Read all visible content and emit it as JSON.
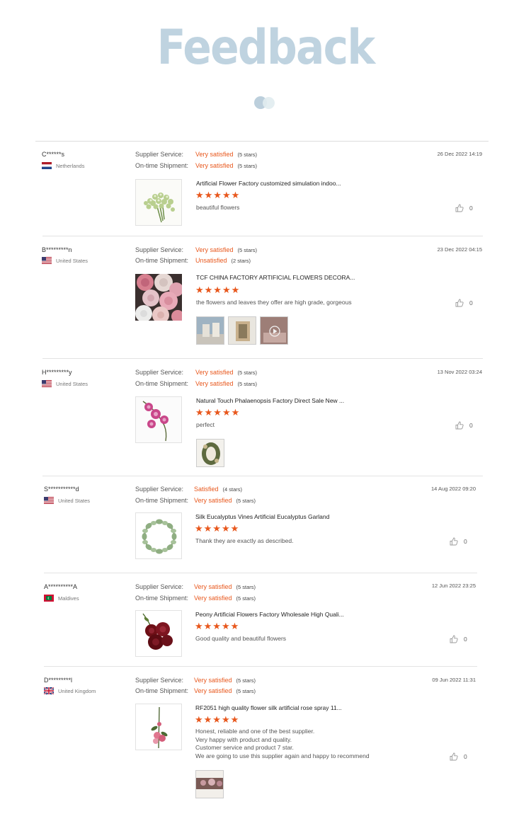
{
  "header": {
    "title": "Feedback"
  },
  "labels": {
    "supplier_service": "Supplier Service:",
    "shipment": "On-time Shipment:"
  },
  "reviews": [
    {
      "user": "C******s",
      "country": "Netherlands",
      "flag": "nl",
      "date": "26 Dec 2022 14:19",
      "supplier": {
        "text": "Very satisfied",
        "stars": "(5 stars)"
      },
      "shipment": {
        "text": "Very satisfied",
        "stars": "(5 stars)"
      },
      "product": "Artificial Flower Factory customized simulation indoo...",
      "rating": 5,
      "rating_text": "★★★★★",
      "comment": "beautiful flowers",
      "likes": "0",
      "thumb_icon": "baby-breath-flower-image"
    },
    {
      "user": "B*********n",
      "country": "United States",
      "flag": "us",
      "date": "23 Dec 2022 04:15",
      "supplier": {
        "text": "Very satisfied",
        "stars": "(5 stars)"
      },
      "shipment": {
        "text": "Unsatisfied",
        "stars": "(2 stars)"
      },
      "product": "TCF CHINA FACTORY ARTIFICIAL FLOWERS DECORA...",
      "rating": 5,
      "rating_text": "★★★★★",
      "comment": "the flowers and leaves they offer are high grade, gorgeous",
      "likes": "0",
      "thumb_icon": "pink-roses-image"
    },
    {
      "user": "H*********y",
      "country": "United States",
      "flag": "us",
      "date": "13 Nov 2022 03:24",
      "supplier": {
        "text": "Very satisfied",
        "stars": "(5 stars)"
      },
      "shipment": {
        "text": "Very satisfied",
        "stars": "(5 stars)"
      },
      "product": "Natural Touch Phalaenopsis Factory Direct Sale New ...",
      "rating": 5,
      "rating_text": "★★★★★",
      "comment": "perfect",
      "likes": "0",
      "thumb_icon": "orchid-image"
    },
    {
      "user": "S***********d",
      "country": "United States",
      "flag": "us",
      "date": "14 Aug 2022 09:20",
      "supplier": {
        "text": "Satisfied",
        "stars": "(4 stars)"
      },
      "shipment": {
        "text": "Very satisfied",
        "stars": "(5 stars)"
      },
      "product": "Silk Eucalyptus Vines Artificial Eucalyptus Garland",
      "rating": 5,
      "rating_text": "★★★★★",
      "comment": "Thank they are exactly as described.",
      "likes": "0",
      "thumb_icon": "eucalyptus-garland-image"
    },
    {
      "user": "A**********A",
      "country": "Maldives",
      "flag": "mv",
      "date": "12 Jun 2022 23:25",
      "supplier": {
        "text": "Very satisfied",
        "stars": "(5 stars)"
      },
      "shipment": {
        "text": "Very satisfied",
        "stars": "(5 stars)"
      },
      "product": "Peony Artificial Flowers Factory Wholesale High Quali...",
      "rating": 5,
      "rating_text": "★★★★★",
      "comment": "Good quality and beautiful flowers",
      "likes": "0",
      "thumb_icon": "red-peony-image"
    },
    {
      "user": "D*********l",
      "country": "United Kingdom",
      "flag": "gb",
      "date": "09 Jun 2022 11:31",
      "supplier": {
        "text": "Very satisfied",
        "stars": "(5 stars)"
      },
      "shipment": {
        "text": "Very satisfied",
        "stars": "(5 stars)"
      },
      "product": "RF2051 high quality flower silk artificial rose spray 11...",
      "rating": 5,
      "rating_text": "★★★★★",
      "comment_lines": [
        "Honest, reliable  and one of the best supplier.",
        "Very happy with product and quality.",
        "Customer service and product  7 star.",
        "We are going to use this supplier again and happy to recommend"
      ],
      "likes": "0",
      "thumb_icon": "rose-spray-image"
    }
  ],
  "colors": {
    "accent": "#e8571c",
    "title": "#bfd3e0"
  }
}
